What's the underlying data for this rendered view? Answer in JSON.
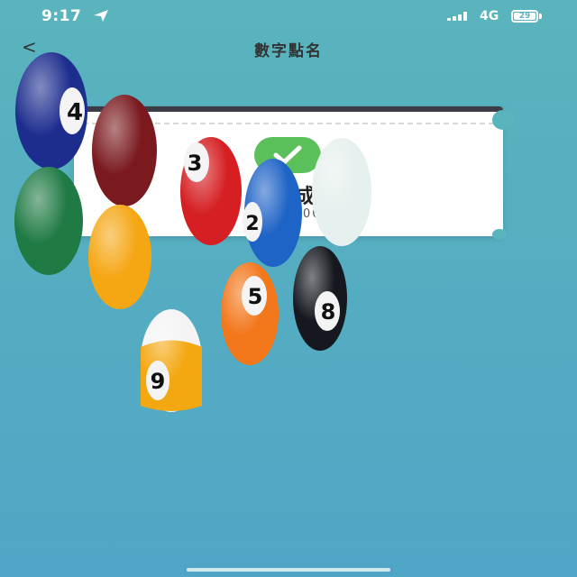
{
  "status": {
    "time": "9:17",
    "network": "4G",
    "battery": "29"
  },
  "nav": {
    "back_label": "<",
    "title": "數字點名"
  },
  "result": {
    "text": "成",
    "code": "0007"
  },
  "balls": [
    "4",
    "3",
    "2",
    "5",
    "8",
    "9"
  ],
  "colors": {
    "accent": "#5bc05a",
    "background": "#5ab4bd"
  }
}
